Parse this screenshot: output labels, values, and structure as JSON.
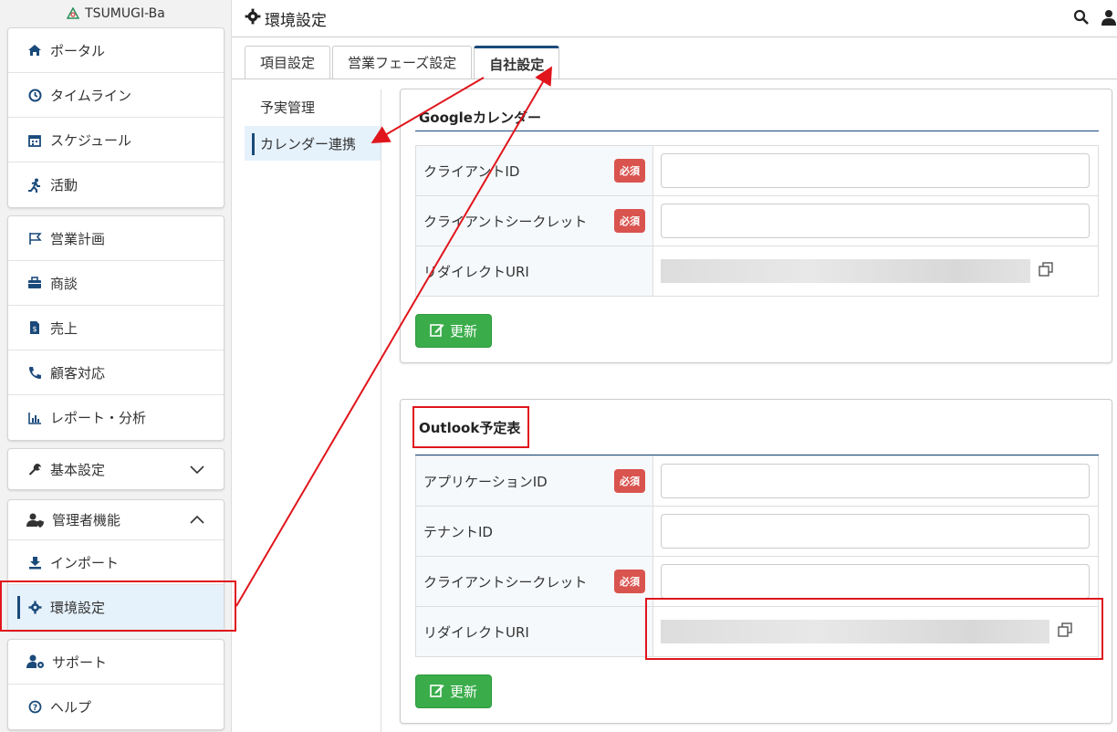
{
  "app": {
    "logo_text": "TSUMUGI-Ba"
  },
  "header": {
    "title": "環境設定"
  },
  "sidebar": {
    "group1": [
      {
        "label": "ポータル",
        "icon": "home-icon"
      },
      {
        "label": "タイムライン",
        "icon": "clock-icon"
      },
      {
        "label": "スケジュール",
        "icon": "calendar-icon"
      },
      {
        "label": "活動",
        "icon": "running-icon"
      }
    ],
    "group2": [
      {
        "label": "営業計画",
        "icon": "flag-icon"
      },
      {
        "label": "商談",
        "icon": "briefcase-icon"
      },
      {
        "label": "売上",
        "icon": "invoice-icon"
      },
      {
        "label": "顧客対応",
        "icon": "phone-icon"
      },
      {
        "label": "レポート・分析",
        "icon": "chart-icon"
      }
    ],
    "basic_settings": {
      "label": "基本設定"
    },
    "admin": {
      "label": "管理者機能",
      "items": [
        {
          "label": "インポート",
          "icon": "download-icon"
        },
        {
          "label": "環境設定",
          "icon": "gear-icon"
        }
      ]
    },
    "group5": [
      {
        "label": "サポート",
        "icon": "user-gear-icon"
      },
      {
        "label": "ヘルプ",
        "icon": "help-icon"
      }
    ]
  },
  "tabs": [
    "項目設定",
    "営業フェーズ設定",
    "自社設定"
  ],
  "submenu": [
    "予実管理",
    "カレンダー連携"
  ],
  "google": {
    "title": "Googleカレンダー",
    "rows": {
      "client_id": "クライアントID",
      "client_secret": "クライアントシークレット",
      "redirect_uri": "リダイレクトURI"
    },
    "update_label": "更新"
  },
  "outlook": {
    "title": "Outlook予定表",
    "rows": {
      "app_id": "アプリケーションID",
      "tenant_id": "テナントID",
      "client_secret": "クライアントシークレット",
      "redirect_uri": "リダイレクトURI"
    },
    "update_label": "更新"
  },
  "required_badge": "必須",
  "colors": {
    "accent": "#1a4a7a",
    "required": "#d9534f",
    "update": "#3aad4a",
    "annotation": "#e0161c"
  }
}
